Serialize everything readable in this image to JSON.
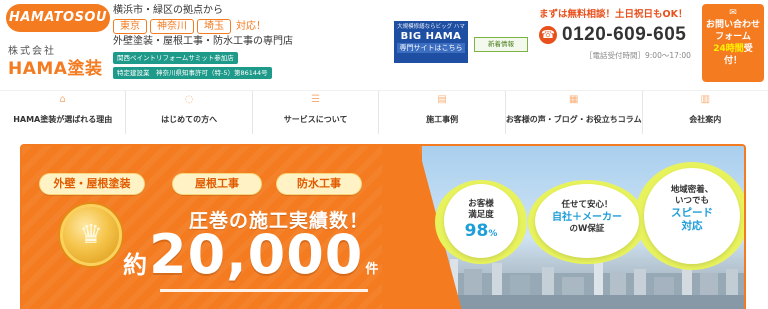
{
  "header": {
    "logo_badge": "HAMATOSOU",
    "logo_small": "株式会社",
    "logo_name": "HAMA塗装",
    "location_line": "横浜市・緑区の拠点から",
    "areas": [
      "東京",
      "神奈川",
      "埼玉"
    ],
    "areas_suffix": "対応！",
    "tagline": "外壁塗装・屋根工事・防水工事の専門店",
    "cert1": "関西ペイントリフォームサミット参加店",
    "cert2": "特定建設業　神奈川県知事許可（特-5）第86144号",
    "bighama_sub": "大規模修繕ならビッグ ハマ",
    "bighama_title": "BIG HAMA",
    "bighama_link": "専門サイトはこちら",
    "news_label": "新着情報",
    "contact_lead": "まずは無料相談！土日祝日もOK！",
    "phone": "0120-609-605",
    "hours": "［電話受付時間］9:00～17:00",
    "cta_icon": "✉",
    "cta_line1": "お問い合わせ",
    "cta_line2": "フォーム",
    "cta_line3_hl": "24時間",
    "cta_line3_rest": "受",
    "cta_line4": "付！"
  },
  "nav": [
    {
      "label": "HAMA塗装が選ばれる理由",
      "icon": "house-icon"
    },
    {
      "label": "はじめての方へ",
      "icon": "chat-icon"
    },
    {
      "label": "サービスについて",
      "icon": "list-icon"
    },
    {
      "label": "施工事例",
      "icon": "document-icon"
    },
    {
      "label": "お客様の声・ブログ・お役立ちコラム",
      "icon": "calendar-icon"
    },
    {
      "label": "会社案内",
      "icon": "building-icon"
    }
  ],
  "hero": {
    "pills": [
      "外壁・屋根塗装",
      "屋根工事",
      "防水工事"
    ],
    "headline": "圧巻の施工実績数！",
    "prefix": "約",
    "number": "20,000",
    "suffix": "件",
    "badge1": {
      "l1": "お客様",
      "l2": "満足度",
      "big": "98",
      "unit": "%"
    },
    "badge2": {
      "l1": "任せて安心！",
      "l2": "自社＋メーカー",
      "l3": "のW保証"
    },
    "badge3": {
      "l1": "地域密着、",
      "l2": "いつでも",
      "l3": "スピード",
      "l4": "対応"
    }
  },
  "colors": {
    "brand": "#f47b20",
    "accent_blue": "#1e9ed9",
    "bighama_blue": "#1f4fa3",
    "cert_teal": "#1e9a8a"
  }
}
